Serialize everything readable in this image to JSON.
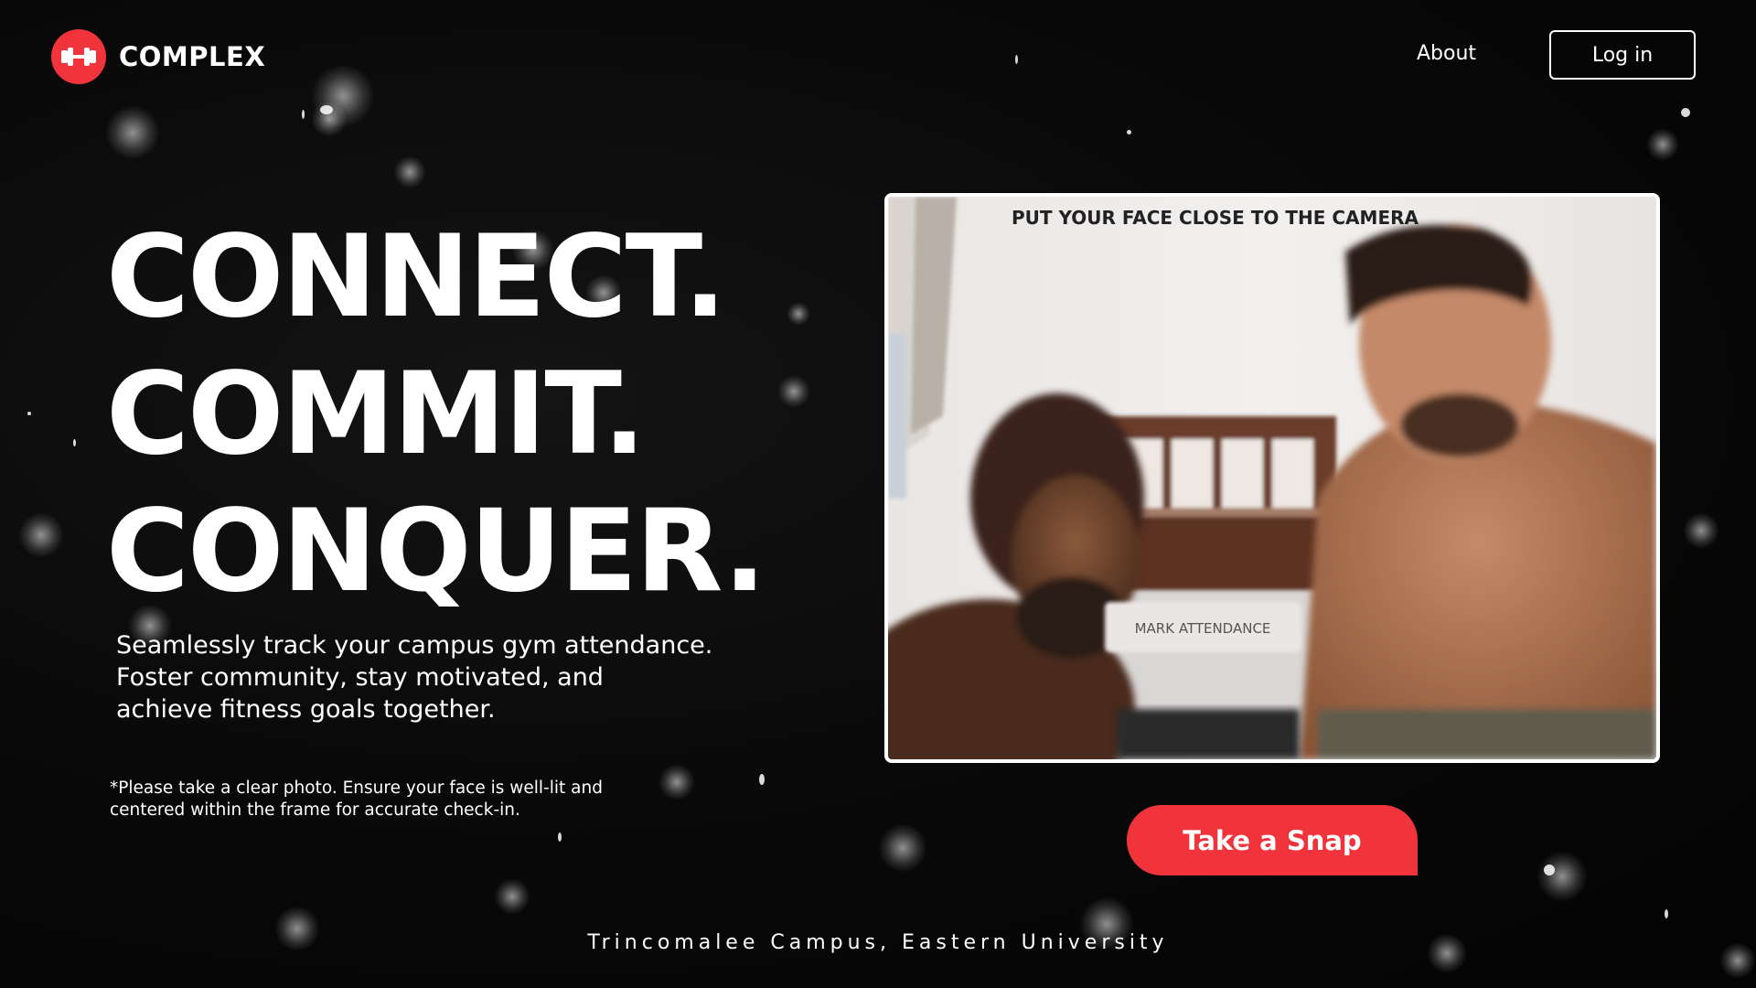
{
  "brand": {
    "name": "COMPLEX",
    "accent_color": "#f1333b",
    "logo_icon": "dumbbell-icon"
  },
  "nav": {
    "about_label": "About",
    "login_label": "Log in"
  },
  "hero": {
    "headline": [
      "CONNECT.",
      "COMMIT.",
      "CONQUER."
    ],
    "tagline": [
      "Seamlessly track your campus gym attendance.",
      "Foster community, stay motivated, and",
      "achieve fitness goals together."
    ],
    "notice": [
      "*Please take a clear photo. Ensure your face is well-lit and",
      "centered within the frame for accurate check-in."
    ]
  },
  "camera": {
    "overlay_text": "PUT YOUR FACE CLOSE TO THE CAMERA",
    "overlay_button": "MARK ATTENDANCE"
  },
  "actions": {
    "snap_label": "Take a Snap"
  },
  "footer": {
    "text": "Trincomalee Campus, Eastern University"
  }
}
